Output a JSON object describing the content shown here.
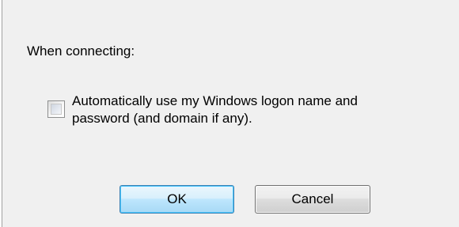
{
  "dialog": {
    "section_label": "When connecting:",
    "checkbox": {
      "checked": false,
      "label_line1": "Automatically use my Windows logon name and",
      "label_line2": "password (and domain if any)."
    },
    "buttons": {
      "ok_label": "OK",
      "cancel_label": "Cancel"
    },
    "colors": {
      "background": "#f0f0f0",
      "ok_button_border": "#3c7fb1",
      "cancel_button_border": "#707070"
    }
  }
}
